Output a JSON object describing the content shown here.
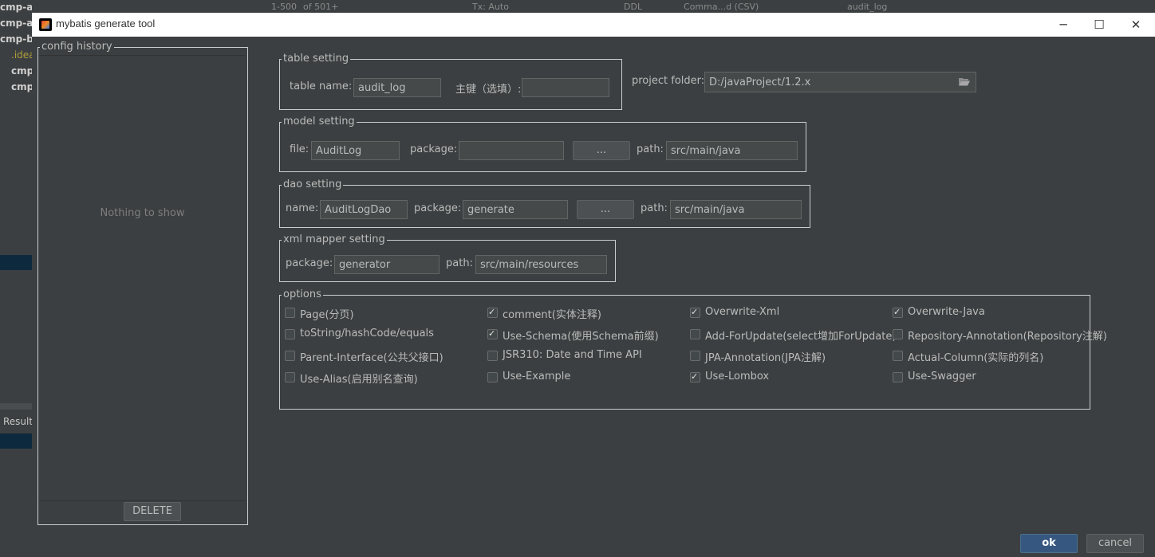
{
  "ide": {
    "toolbar": [
      "1-500",
      "of 501+",
      "Tx: Auto",
      "DDL",
      "Comma...d (CSV)",
      "audit_log"
    ],
    "projects": [
      "cmp-adapter-vmware",
      "cmp-as",
      "cmp-bi",
      ".idea",
      "cmp",
      "cmp"
    ],
    "result_label": "Result"
  },
  "dialog": {
    "title": "mybatis generate tool",
    "window_buttons": {
      "minimize": "─",
      "maximize": "☐",
      "close": "✕"
    },
    "config_history": {
      "legend": "config history",
      "empty_text": "Nothing to show",
      "delete_label": "DELETE"
    },
    "table_setting": {
      "legend": "table setting",
      "name_label": "table  name:",
      "name_value": "audit_log",
      "pk_label": "主键（选填）:",
      "pk_value": ""
    },
    "project_folder": {
      "label": "project folder:",
      "value": "D:/javaProject/1.2.x",
      "icon": "folder-open-icon"
    },
    "model_setting": {
      "legend": "model setting",
      "file_label": "file:",
      "file_value": "AuditLog",
      "package_label": "package:",
      "package_value": "",
      "browse_label": "...",
      "path_label": "path:",
      "path_value": "src/main/java"
    },
    "dao_setting": {
      "legend": "dao setting",
      "name_label": "name:",
      "name_value": "AuditLogDao",
      "package_label": "package:",
      "package_value": "generate",
      "browse_label": "...",
      "path_label": "path:",
      "path_value": "src/main/java"
    },
    "xml_mapper_setting": {
      "legend": "xml mapper setting",
      "package_label": "package:",
      "package_value": "generator",
      "path_label": "path:",
      "path_value": "src/main/resources"
    },
    "options": {
      "legend": "options",
      "items": [
        {
          "label": "Page(分页)",
          "checked": false
        },
        {
          "label": "comment(实体注释)",
          "checked": true
        },
        {
          "label": "Overwrite-Xml",
          "checked": true
        },
        {
          "label": "Overwrite-Java",
          "checked": true
        },
        {
          "label": "toString/hashCode/equals",
          "checked": false
        },
        {
          "label": "Use-Schema(使用Schema前缀)",
          "checked": true
        },
        {
          "label": "Add-ForUpdate(select增加ForUpdate)",
          "checked": false
        },
        {
          "label": "Repository-Annotation(Repository注解)",
          "checked": false
        },
        {
          "label": "Parent-Interface(公共父接口)",
          "checked": false
        },
        {
          "label": "JSR310: Date and Time API",
          "checked": false
        },
        {
          "label": "JPA-Annotation(JPA注解)",
          "checked": false
        },
        {
          "label": "Actual-Column(实际的列名)",
          "checked": false
        },
        {
          "label": "Use-Alias(启用别名查询)",
          "checked": false
        },
        {
          "label": "Use-Example",
          "checked": false
        },
        {
          "label": "Use-Lombox",
          "checked": true
        },
        {
          "label": "Use-Swagger",
          "checked": false
        }
      ]
    },
    "ok_label": "ok",
    "cancel_label": "cancel",
    "colors": {
      "accent": "#365880",
      "background": "#3c3f41",
      "field": "#45494a"
    }
  }
}
